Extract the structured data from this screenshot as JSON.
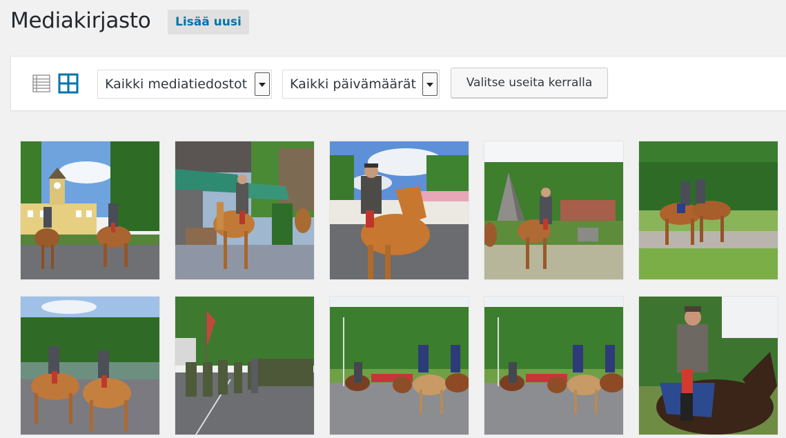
{
  "header": {
    "title": "Mediakirjasto",
    "add_new_label": "Lisää uusi"
  },
  "toolbar": {
    "view_modes": [
      "list-view-icon",
      "grid-view-icon"
    ],
    "active_view": "grid",
    "media_type_filter": {
      "selected": "Kaikki mediatiedostot"
    },
    "date_filter": {
      "selected": "Kaikki päivämäärät"
    },
    "bulk_select_label": "Valitse useita kerralla"
  },
  "media_items": [
    {
      "alt": "Cavalry riders in front of yellow building with clock tower"
    },
    {
      "alt": "Rider on chestnut horse near café umbrellas"
    },
    {
      "alt": "Close-up of rider on chestnut horse"
    },
    {
      "alt": "Rider beside stone pyramid monument"
    },
    {
      "alt": "Two riders on grass field"
    },
    {
      "alt": "Two riders by canal"
    },
    {
      "alt": "Marching soldiers with flag"
    },
    {
      "alt": "Mounted parade on road"
    },
    {
      "alt": "Mounted parade on road, second shot"
    },
    {
      "alt": "Officer on dark horse with blue saddle cloth"
    }
  ],
  "colors": {
    "accent": "#0073aa",
    "background": "#f1f1f1",
    "toolbar": "#ffffff"
  }
}
